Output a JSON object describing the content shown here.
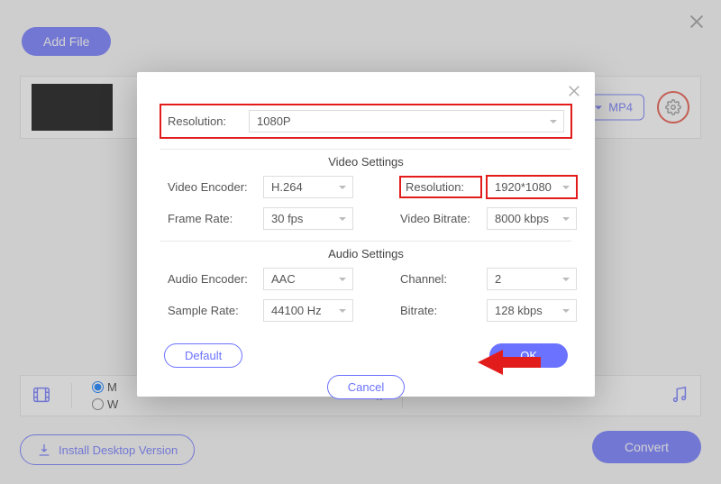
{
  "header": {
    "add_file_label": "Add File"
  },
  "file_row": {
    "format_label": "MP4"
  },
  "bottom_bar": {
    "radio1_letter": "M",
    "radio2_letter": "W",
    "right_letter": "k"
  },
  "install": {
    "label": "Install Desktop Version"
  },
  "convert": {
    "label": "Convert"
  },
  "dialog": {
    "top": {
      "resolution_label": "Resolution:",
      "resolution_value": "1080P"
    },
    "video_section_title": "Video Settings",
    "video": {
      "encoder_label": "Video Encoder:",
      "encoder_value": "H.264",
      "resolution_label": "Resolution:",
      "resolution_value": "1920*1080",
      "framerate_label": "Frame Rate:",
      "framerate_value": "30 fps",
      "bitrate_label": "Video Bitrate:",
      "bitrate_value": "8000 kbps"
    },
    "audio_section_title": "Audio Settings",
    "audio": {
      "encoder_label": "Audio Encoder:",
      "encoder_value": "AAC",
      "channel_label": "Channel:",
      "channel_value": "2",
      "samplerate_label": "Sample Rate:",
      "samplerate_value": "44100 Hz",
      "bitrate_label": "Bitrate:",
      "bitrate_value": "128 kbps"
    },
    "default_label": "Default",
    "ok_label": "OK",
    "cancel_label": "Cancel"
  }
}
